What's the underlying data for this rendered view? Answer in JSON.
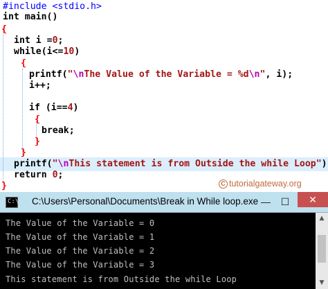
{
  "code": {
    "include": "#include <stdio.h>",
    "main_sig": "int main()",
    "open_main": "{",
    "decl_kw": "int",
    "decl_rest": " i =",
    "decl_num": "0",
    "decl_end": ";",
    "while_kw": "while",
    "while_rest": "(i<=",
    "while_num": "10",
    "while_end": ")",
    "open_while": "{",
    "printf1_fn": "printf(",
    "printf1_q1": "\"",
    "printf1_esc": "\\n",
    "printf1_str": "The Value of the Variable = %d",
    "printf1_esc2": "\\n",
    "printf1_q2": "\"",
    "printf1_rest": ", i);",
    "incr": "i++;",
    "if_kw": "if",
    "if_rest": " (i==",
    "if_num": "4",
    "if_end": ")",
    "open_if": "{",
    "break_kw": "break",
    "break_end": ";",
    "close_if": "}",
    "close_while": "}",
    "printf2_fn": "printf(",
    "printf2_q1": "\"",
    "printf2_esc": "\\n",
    "printf2_str": "This statement is from Outside the while Loop",
    "printf2_q2": "\"",
    "printf2_rest": ");",
    "return_kw": "return",
    "return_num": "0",
    "return_end": ";",
    "close_main": "}"
  },
  "watermark": {
    "icon": "copyright-icon",
    "symbol": "C",
    "text": "tutorialgateway.org"
  },
  "console": {
    "title": "C:\\Users\\Personal\\Documents\\Break in While loop.exe",
    "minimize": "—",
    "maximize": "☐",
    "close": "✕",
    "lines": [
      "The Value of the Variable = 0",
      "The Value of the Variable = 1",
      "The Value of the Variable = 2",
      "The Value of the Variable = 3",
      "This statement is from Outside the while Loop"
    ],
    "scroll_up": "▲",
    "scroll_down": "▼"
  },
  "colors": {
    "keyword": "#0000ff",
    "string": "#a31515",
    "brace": "#ff0000",
    "highlight": "#dbeefc",
    "console_bg": "#000000",
    "titlebar": "#bfe0ef"
  }
}
